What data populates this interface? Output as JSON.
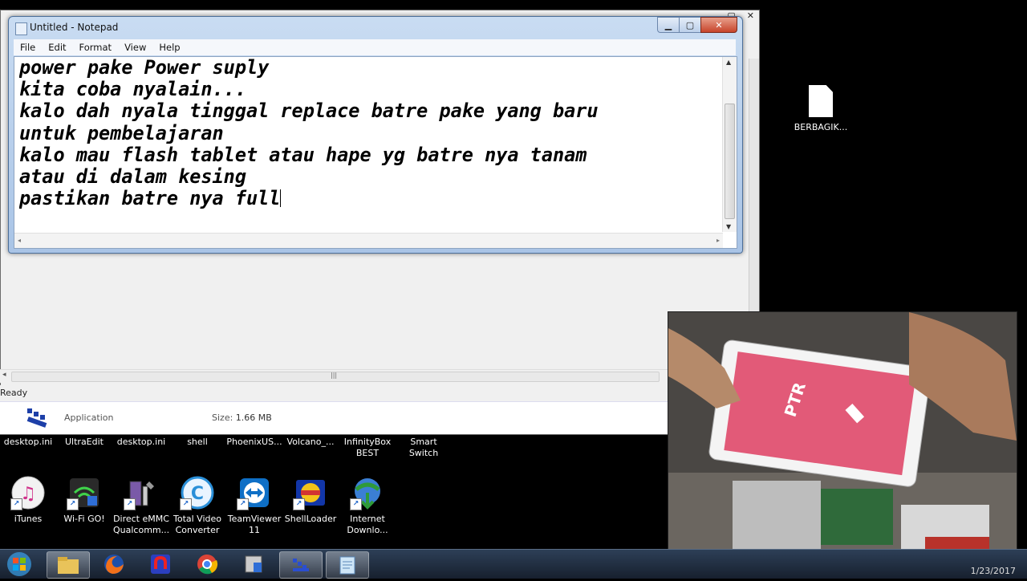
{
  "background_window": {
    "status_text": "Ready",
    "details": {
      "kind": "Application",
      "size_label": "Size:",
      "size_value": "1.66 MB"
    }
  },
  "notepad": {
    "title": "Untitled - Notepad",
    "menu": [
      "File",
      "Edit",
      "Format",
      "View",
      "Help"
    ],
    "text_lines": [
      "power pake Power suply",
      "kita coba nyalain...",
      "kalo dah nyala tinggal replace batre pake yang baru",
      "untuk pembelajaran",
      "kalo mau flash tablet atau hape yg batre nya tanam",
      "atau di dalam kesing",
      "pastikan batre nya full"
    ]
  },
  "desktop": {
    "label_row": [
      "desktop.ini",
      "UltraEdit",
      "desktop.ini",
      "shell",
      "PhoenixUS...",
      "Volcano_...",
      "InfinityBox BEST",
      "Smart Switch"
    ],
    "icons": [
      {
        "name": "iTunes",
        "label": "iTunes",
        "color": "#e0e0e0"
      },
      {
        "name": "wifi-go",
        "label": "Wi-Fi GO!",
        "color": "#1a1a1a"
      },
      {
        "name": "direct-emmc",
        "label": "Direct eMMC Qualcomm...",
        "color": "#6a4b8f"
      },
      {
        "name": "total-video-converter",
        "label": "Total Video Converter",
        "color": "#2a8fd8"
      },
      {
        "name": "teamviewer",
        "label": "TeamViewer 11",
        "color": "#0e6fc6"
      },
      {
        "name": "shellloader",
        "label": "ShellLoader",
        "color": "#1236a8"
      },
      {
        "name": "internet-download-manager",
        "label": "Internet Downlo...",
        "color": "#2f9a3a"
      }
    ],
    "file_icon_label": "BERBAGIK..."
  },
  "taskbar": {
    "clock": "1/23/2017"
  }
}
